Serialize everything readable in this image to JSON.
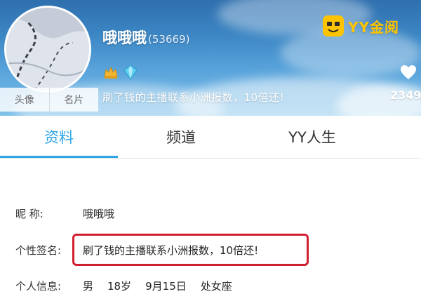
{
  "header": {
    "username": "哦哦哦",
    "user_id": "(53669)",
    "tagline": "刷了钱的主播联系小洲报数，10倍还!",
    "buttons": [
      "头像",
      "名片"
    ],
    "logo_text": "YY金阅",
    "like_count": "2349"
  },
  "tabs": [
    {
      "label": "资料",
      "active": true
    },
    {
      "label": "频道",
      "active": false
    },
    {
      "label": "YY人生",
      "active": false
    }
  ],
  "profile": {
    "nickname_label": "昵    称:",
    "nickname": "哦哦哦",
    "signature_label": "个性签名:",
    "signature": "刷了钱的主播联系小洲报数，10倍还!",
    "personal_info_label": "个人信息:",
    "personal_info": {
      "gender": "男",
      "age": "18岁",
      "birthday": "9月15日",
      "zodiac": "处女座"
    }
  },
  "colors": {
    "accent_blue": "#2ea6e6",
    "highlight_red": "#d01f2f",
    "logo_yellow": "#ffc400"
  }
}
